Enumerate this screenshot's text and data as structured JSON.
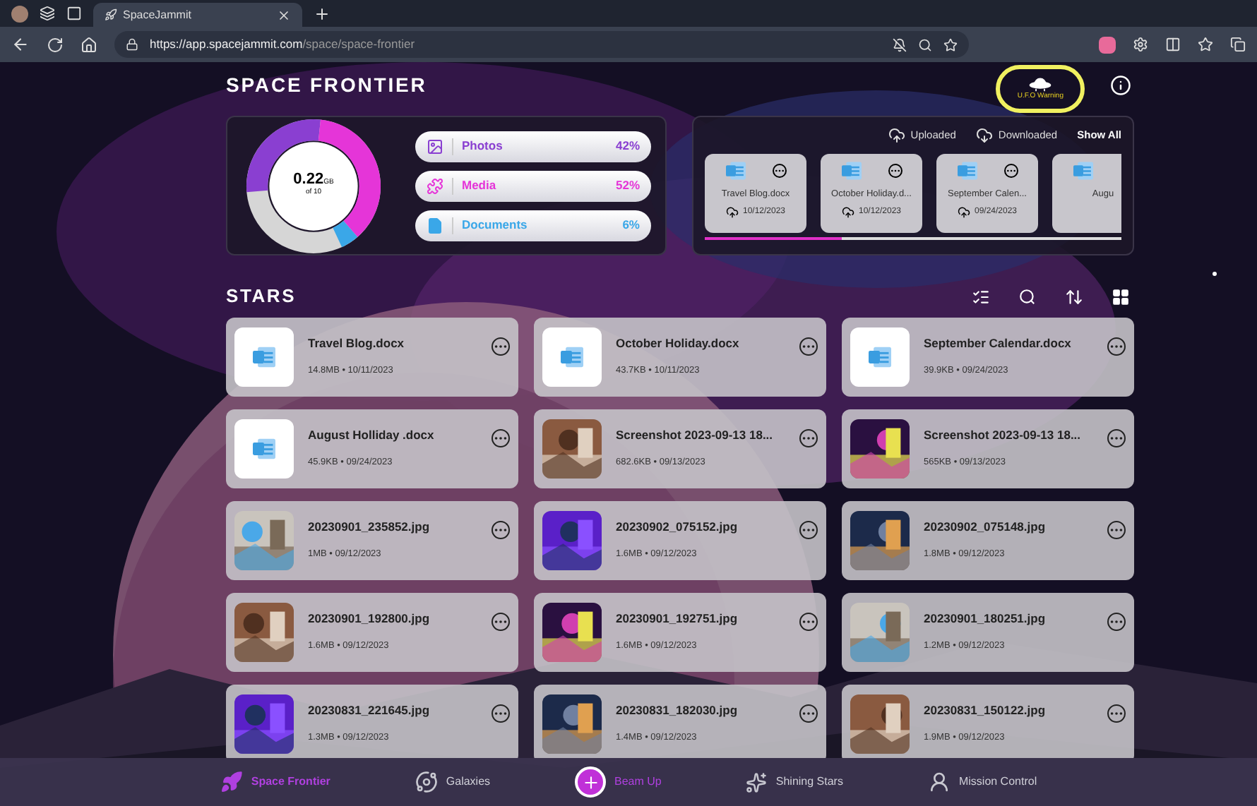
{
  "browser": {
    "tab_title": "SpaceJammit",
    "url_host": "https://app.spacejammit.com",
    "url_path": "/space/space-frontier"
  },
  "page_title": "SPACE FRONTIER",
  "ufo_warning": {
    "label": "U.F.O Warning"
  },
  "storage": {
    "used": "0.22",
    "unit": "GB",
    "total": "of 10",
    "categories": [
      {
        "kind": "photos",
        "label": "Photos",
        "percent": "42%",
        "color": "#8a3fd1"
      },
      {
        "kind": "media",
        "label": "Media",
        "percent": "52%",
        "color": "#e535d8"
      },
      {
        "kind": "documents",
        "label": "Documents",
        "percent": "6%",
        "color": "#3aa7e8"
      }
    ]
  },
  "recent": {
    "filters": [
      {
        "kind": "upload",
        "label": "Uploaded",
        "selected": false
      },
      {
        "kind": "download",
        "label": "Downloaded",
        "selected": false
      },
      {
        "kind": "all",
        "label": "Show All",
        "selected": true
      }
    ],
    "files": [
      {
        "name": "Travel Blog.docx",
        "date": "10/12/2023"
      },
      {
        "name": "October Holiday.d...",
        "date": "10/12/2023"
      },
      {
        "name": "September Calen...",
        "date": "09/24/2023"
      },
      {
        "name": "Augu"
      }
    ]
  },
  "section_title": "STARS",
  "files": [
    {
      "kind": "doc",
      "name": "Travel Blog.docx",
      "meta": "14.8MB • 10/11/2023"
    },
    {
      "kind": "doc",
      "name": "October Holiday.docx",
      "meta": "43.7KB • 10/11/2023"
    },
    {
      "kind": "doc",
      "name": "September Calendar.docx",
      "meta": "39.9KB • 09/24/2023"
    },
    {
      "kind": "doc",
      "name": "August Holliday .docx",
      "meta": "45.9KB • 09/24/2023"
    },
    {
      "kind": "picture",
      "name": "Screenshot 2023-09-13 18...",
      "meta": "682.6KB • 09/13/2023"
    },
    {
      "kind": "picture",
      "name": "Screenshot 2023-09-13 18...",
      "meta": "565KB • 09/13/2023"
    },
    {
      "kind": "picture",
      "name": "20230901_235852.jpg",
      "meta": "1MB • 09/12/2023"
    },
    {
      "kind": "picture",
      "name": "20230902_075152.jpg",
      "meta": "1.6MB • 09/12/2023"
    },
    {
      "kind": "picture",
      "name": "20230902_075148.jpg",
      "meta": "1.8MB • 09/12/2023"
    },
    {
      "kind": "picture",
      "name": "20230901_192800.jpg",
      "meta": "1.6MB • 09/12/2023"
    },
    {
      "kind": "picture",
      "name": "20230901_192751.jpg",
      "meta": "1.6MB • 09/12/2023"
    },
    {
      "kind": "picture",
      "name": "20230901_180251.jpg",
      "meta": "1.2MB • 09/12/2023"
    },
    {
      "kind": "picture",
      "name": "20230831_221645.jpg",
      "meta": "1.3MB • 09/12/2023"
    },
    {
      "kind": "picture",
      "name": "20230831_182030.jpg",
      "meta": "1.4MB • 09/12/2023"
    },
    {
      "kind": "picture",
      "name": "20230831_150122.jpg",
      "meta": "1.9MB • 09/12/2023"
    }
  ],
  "nav": [
    {
      "kind": "rocket",
      "label": "Space Frontier",
      "selected": true
    },
    {
      "kind": "galaxy",
      "label": "Galaxies",
      "selected": false
    },
    {
      "kind": "add",
      "label": "Beam Up",
      "selected": false
    },
    {
      "kind": "sparkle",
      "label": "Shining Stars",
      "selected": false
    },
    {
      "kind": "person",
      "label": "Mission Control",
      "selected": false
    }
  ]
}
